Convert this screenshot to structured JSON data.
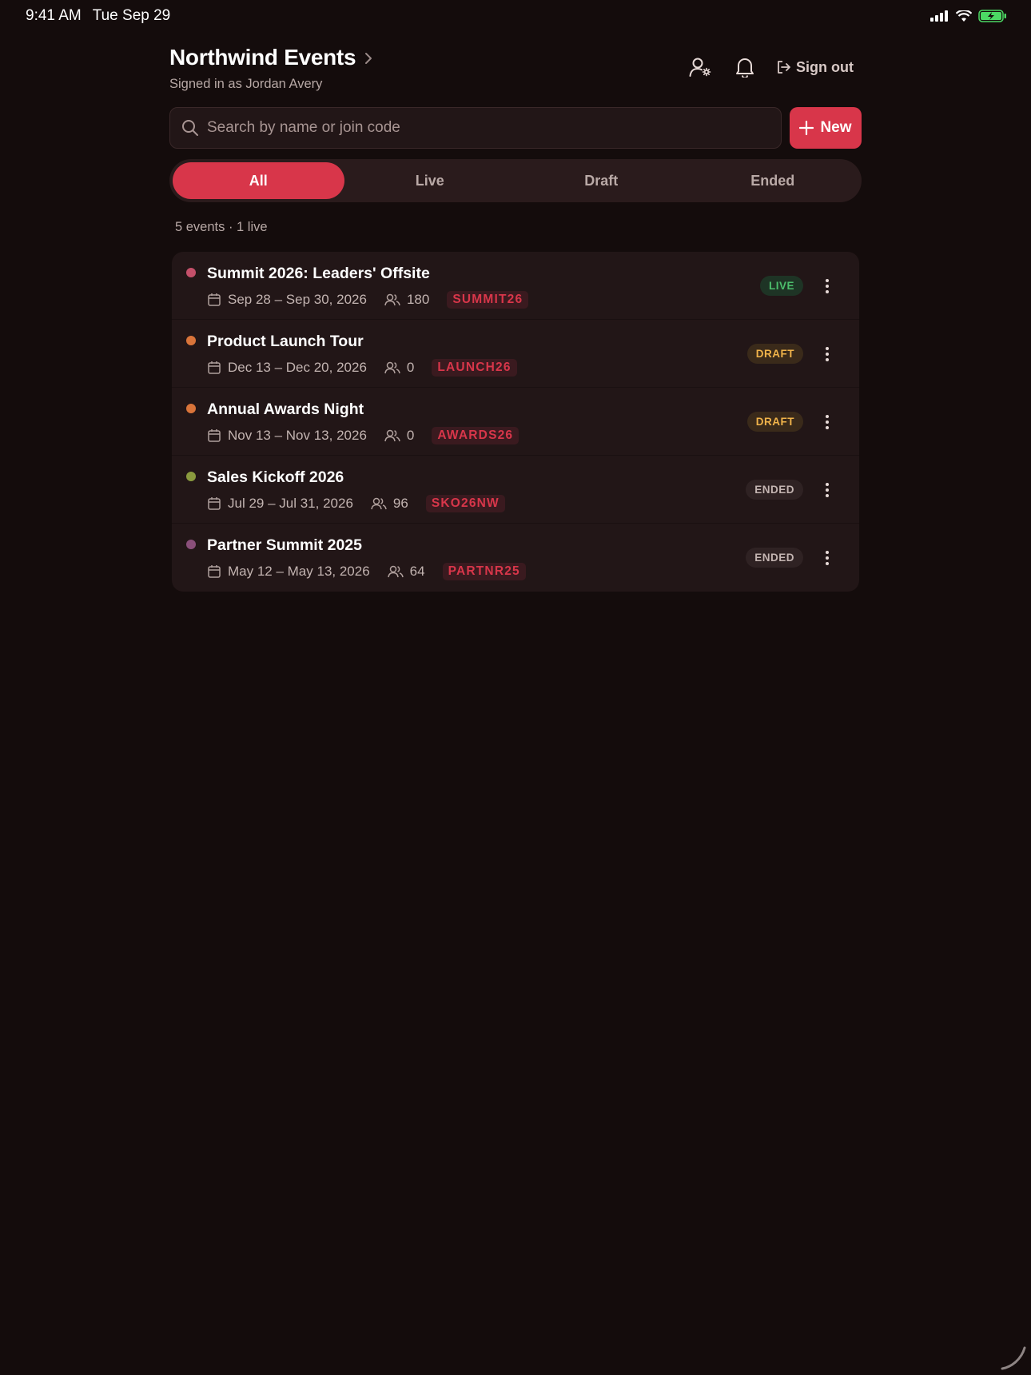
{
  "status_bar": {
    "time": "9:41 AM",
    "date": "Tue Sep 29"
  },
  "header": {
    "title": "Northwind Events",
    "subtitle": "Signed in as Jordan Avery",
    "sign_out_label": "Sign out"
  },
  "search": {
    "placeholder": "Search by name or join code",
    "value": ""
  },
  "new_button_label": "New",
  "tabs": [
    {
      "label": "All",
      "active": true
    },
    {
      "label": "Live",
      "active": false
    },
    {
      "label": "Draft",
      "active": false
    },
    {
      "label": "Ended",
      "active": false
    }
  ],
  "summary": "5 events · 1 live",
  "events": [
    {
      "title": "Summit 2026: Leaders' Offsite",
      "dates": "Sep 28 – Sep 30, 2026",
      "attendees": "180",
      "code": "SUMMIT26",
      "status": "LIVE",
      "dot_color": "#c4506a"
    },
    {
      "title": "Product Launch Tour",
      "dates": "Dec 13 – Dec 20, 2026",
      "attendees": "0",
      "code": "LAUNCH26",
      "status": "DRAFT",
      "dot_color": "#d9743a"
    },
    {
      "title": "Annual Awards Night",
      "dates": "Nov 13 – Nov 13, 2026",
      "attendees": "0",
      "code": "AWARDS26",
      "status": "DRAFT",
      "dot_color": "#d9743a"
    },
    {
      "title": "Sales Kickoff 2026",
      "dates": "Jul 29 – Jul 31, 2026",
      "attendees": "96",
      "code": "SKO26NW",
      "status": "ENDED",
      "dot_color": "#8a9a3e"
    },
    {
      "title": "Partner Summit 2025",
      "dates": "May 12 – May 13, 2026",
      "attendees": "64",
      "code": "PARTNR25",
      "status": "ENDED",
      "dot_color": "#8a4f7a"
    }
  ],
  "colors": {
    "accent": "#d8364a",
    "background": "#140c0c",
    "card": "#221617",
    "live": "#4cbe6c",
    "draft": "#f0b34a"
  }
}
